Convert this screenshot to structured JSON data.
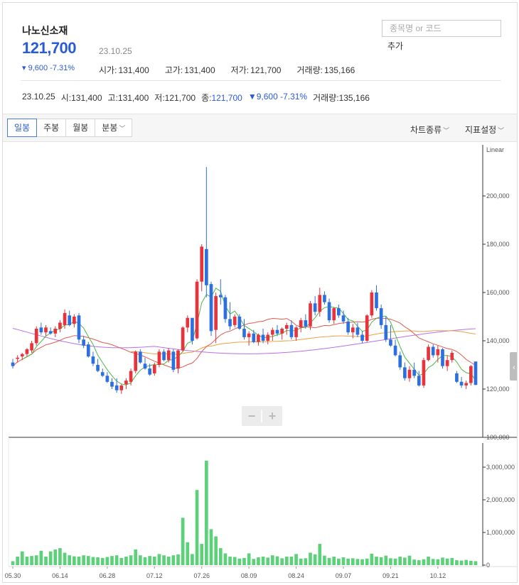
{
  "header": {
    "stock_name": "나노신소재",
    "price": "121,700",
    "date": "23.10.25",
    "change": "▾ 9,600 -7.31%",
    "ohlc": [
      {
        "label": "시가",
        "value": "131,400"
      },
      {
        "label": "고가",
        "value": "131,400"
      },
      {
        "label": "저가",
        "value": "121,700"
      },
      {
        "label": "거래량",
        "value": "135,166"
      }
    ]
  },
  "search": {
    "placeholder": "종목명 or 코드",
    "add_label": "추가"
  },
  "info": {
    "date": "23.10.25",
    "open_label": "시",
    "open": "131,400",
    "high_label": "고",
    "high": "131,400",
    "low_label": "저",
    "low": "121,700",
    "close_label": "종",
    "close": "121,700",
    "change": "▼9,600 -7.31%",
    "volume_label": "거래량",
    "volume": "135,166"
  },
  "toolbar": {
    "tabs": [
      "일봉",
      "주봉",
      "월봉",
      "분봉"
    ],
    "active_tab": 0,
    "chart_type": "차트종류",
    "indicator": "지표설정"
  },
  "zoom": {
    "minus": "−",
    "plus": "+"
  },
  "colors": {
    "up": "#e8323c",
    "down": "#2c6fe0",
    "volume": "#5dd17a",
    "ma5": "#4cb648",
    "ma20": "#e05a4c",
    "ma60": "#f0a040",
    "ma120": "#b870e8",
    "accent": "#2a5bd7"
  },
  "chart_data": {
    "type": "candlestick",
    "scale_label": "Linear",
    "price_ticks": [
      "200,000",
      "180,000",
      "160,000",
      "140,000",
      "120,000",
      "100,000"
    ],
    "price_tick_values": [
      200000,
      180000,
      160000,
      140000,
      120000,
      100000
    ],
    "volume_ticks": [
      "3,000,000",
      "2,000,000",
      "1,000,000",
      "0"
    ],
    "volume_tick_values": [
      3000000,
      2000000,
      1000000,
      0
    ],
    "x_labels": [
      {
        "i": 0,
        "label": "05.30"
      },
      {
        "i": 10,
        "label": "06.14"
      },
      {
        "i": 20,
        "label": "06.28"
      },
      {
        "i": 30,
        "label": "07.12"
      },
      {
        "i": 40,
        "label": "07.26"
      },
      {
        "i": 50,
        "label": "08.09"
      },
      {
        "i": 60,
        "label": "08.24"
      },
      {
        "i": 70,
        "label": "09.07"
      },
      {
        "i": 80,
        "label": "09.21"
      },
      {
        "i": 90,
        "label": "10.12"
      }
    ],
    "candles": [
      [
        131000,
        132500,
        128500,
        129500
      ],
      [
        132500,
        134000,
        131000,
        133000
      ],
      [
        133500,
        135000,
        132000,
        134500
      ],
      [
        134500,
        137000,
        133500,
        136500
      ],
      [
        136000,
        140000,
        135000,
        139000
      ],
      [
        139000,
        146000,
        138000,
        145000
      ],
      [
        145500,
        147500,
        142500,
        143500
      ],
      [
        143500,
        146500,
        142000,
        145500
      ],
      [
        144000,
        145500,
        142500,
        143000
      ],
      [
        143000,
        146000,
        141500,
        145000
      ],
      [
        145000,
        148500,
        143500,
        147500
      ],
      [
        146500,
        153000,
        145000,
        151500
      ],
      [
        150500,
        152500,
        146000,
        146500
      ],
      [
        147000,
        151000,
        145500,
        150000
      ],
      [
        150500,
        151500,
        139000,
        140500
      ],
      [
        140500,
        142000,
        137000,
        138000
      ],
      [
        138500,
        139500,
        133000,
        133500
      ],
      [
        133500,
        135500,
        129500,
        130500
      ],
      [
        130000,
        132500,
        127000,
        127500
      ],
      [
        127000,
        128500,
        125000,
        125500
      ],
      [
        125500,
        127000,
        122500,
        123000
      ],
      [
        123000,
        124500,
        120000,
        121000
      ],
      [
        121500,
        124500,
        118500,
        119500
      ],
      [
        119500,
        122000,
        118000,
        121500
      ],
      [
        122000,
        124500,
        120000,
        123500
      ],
      [
        123000,
        128500,
        121500,
        127500
      ],
      [
        127500,
        136000,
        126500,
        135500
      ],
      [
        135500,
        136500,
        130500,
        131000
      ],
      [
        130500,
        133000,
        128000,
        128500
      ],
      [
        128500,
        130500,
        125500,
        126000
      ],
      [
        126500,
        131000,
        125500,
        130000
      ],
      [
        130000,
        136500,
        129000,
        135500
      ],
      [
        135500,
        136500,
        131500,
        132000
      ],
      [
        132000,
        137000,
        131000,
        136000
      ],
      [
        135500,
        136500,
        127000,
        128000
      ],
      [
        128500,
        136500,
        126500,
        136000
      ],
      [
        136000,
        146000,
        135500,
        145500
      ],
      [
        145500,
        150500,
        143500,
        149500
      ],
      [
        149500,
        147000,
        138500,
        140000
      ],
      [
        141000,
        165500,
        140500,
        164500
      ],
      [
        164500,
        180000,
        160500,
        179000
      ],
      [
        178000,
        212000,
        158000,
        163000
      ],
      [
        163500,
        164500,
        142000,
        144000
      ],
      [
        144500,
        160000,
        139000,
        158500
      ],
      [
        159000,
        165500,
        155000,
        158000
      ],
      [
        158000,
        159000,
        147500,
        149000
      ],
      [
        149000,
        156000,
        144500,
        146000
      ],
      [
        146500,
        151000,
        145500,
        150000
      ],
      [
        150000,
        151000,
        144500,
        145000
      ],
      [
        145000,
        149000,
        140500,
        141500
      ],
      [
        141500,
        144000,
        138000,
        143000
      ],
      [
        143000,
        144500,
        139000,
        139500
      ],
      [
        139500,
        143000,
        138000,
        142500
      ],
      [
        142500,
        145000,
        139000,
        140000
      ],
      [
        140000,
        143500,
        138500,
        142500
      ],
      [
        142500,
        145500,
        140000,
        144500
      ],
      [
        144500,
        146500,
        142000,
        143000
      ],
      [
        143000,
        145500,
        140500,
        145000
      ],
      [
        145000,
        147500,
        142500,
        146500
      ],
      [
        146500,
        148500,
        140500,
        141500
      ],
      [
        141500,
        146000,
        140000,
        145500
      ],
      [
        145500,
        149500,
        143500,
        148500
      ],
      [
        148500,
        151000,
        145000,
        146000
      ],
      [
        146000,
        156500,
        144500,
        155500
      ],
      [
        155500,
        158500,
        150500,
        152000
      ],
      [
        152000,
        162000,
        150000,
        159000
      ],
      [
        159000,
        160500,
        155000,
        156000
      ],
      [
        156000,
        157500,
        147500,
        148500
      ],
      [
        148500,
        154000,
        147000,
        153500
      ],
      [
        153500,
        155000,
        149500,
        150500
      ],
      [
        150500,
        152500,
        147000,
        148000
      ],
      [
        148000,
        149500,
        142500,
        143500
      ],
      [
        143500,
        147000,
        141000,
        145500
      ],
      [
        145500,
        147500,
        141500,
        142500
      ],
      [
        142500,
        144000,
        139000,
        140000
      ],
      [
        140000,
        151000,
        139500,
        150500
      ],
      [
        150500,
        161000,
        149500,
        160000
      ],
      [
        160000,
        163000,
        152500,
        153500
      ],
      [
        153500,
        155000,
        145000,
        146500
      ],
      [
        146500,
        150000,
        139500,
        140500
      ],
      [
        140500,
        146500,
        137500,
        138000
      ],
      [
        138000,
        140500,
        133500,
        134000
      ],
      [
        134000,
        135500,
        128000,
        129000
      ],
      [
        129000,
        131000,
        123500,
        124500
      ],
      [
        124500,
        129500,
        123000,
        128000
      ],
      [
        128000,
        131000,
        124500,
        125500
      ],
      [
        125500,
        127500,
        121000,
        121500
      ],
      [
        121500,
        133000,
        120500,
        132000
      ],
      [
        132000,
        138500,
        131500,
        137500
      ],
      [
        137500,
        138500,
        133000,
        134000
      ],
      [
        134000,
        138000,
        131000,
        136500
      ],
      [
        136500,
        137000,
        128500,
        129500
      ],
      [
        129500,
        134000,
        127500,
        132000
      ],
      [
        132000,
        136000,
        131000,
        135000
      ],
      [
        126500,
        127500,
        122500,
        123000
      ],
      [
        123000,
        125000,
        120500,
        121500
      ],
      [
        121500,
        123500,
        120000,
        122500
      ],
      [
        122500,
        130000,
        121500,
        129500
      ],
      [
        131400,
        131400,
        121700,
        121700
      ]
    ],
    "volumes": [
      120000,
      260000,
      420000,
      260000,
      280000,
      300000,
      440000,
      260000,
      420000,
      480000,
      520000,
      380000,
      300000,
      270000,
      260000,
      300000,
      280000,
      250000,
      240000,
      220000,
      250000,
      280000,
      300000,
      220000,
      260000,
      300000,
      480000,
      300000,
      240000,
      280000,
      260000,
      340000,
      300000,
      260000,
      300000,
      330000,
      1450000,
      700000,
      340000,
      2300000,
      650000,
      3200000,
      1100000,
      880000,
      520000,
      360000,
      260000,
      250000,
      200000,
      220000,
      360000,
      190000,
      240000,
      260000,
      230000,
      300000,
      270000,
      210000,
      260000,
      260000,
      340000,
      200000,
      210000,
      380000,
      330000,
      650000,
      290000,
      220000,
      260000,
      200000,
      240000,
      200000,
      210000,
      190000,
      180000,
      200000,
      350000,
      260000,
      240000,
      290000,
      210000,
      200000,
      260000,
      230000,
      290000,
      170000,
      150000,
      180000,
      260000,
      190000,
      180000,
      230000,
      200000,
      220000,
      150000,
      140000,
      160000,
      130000,
      120000
    ]
  }
}
